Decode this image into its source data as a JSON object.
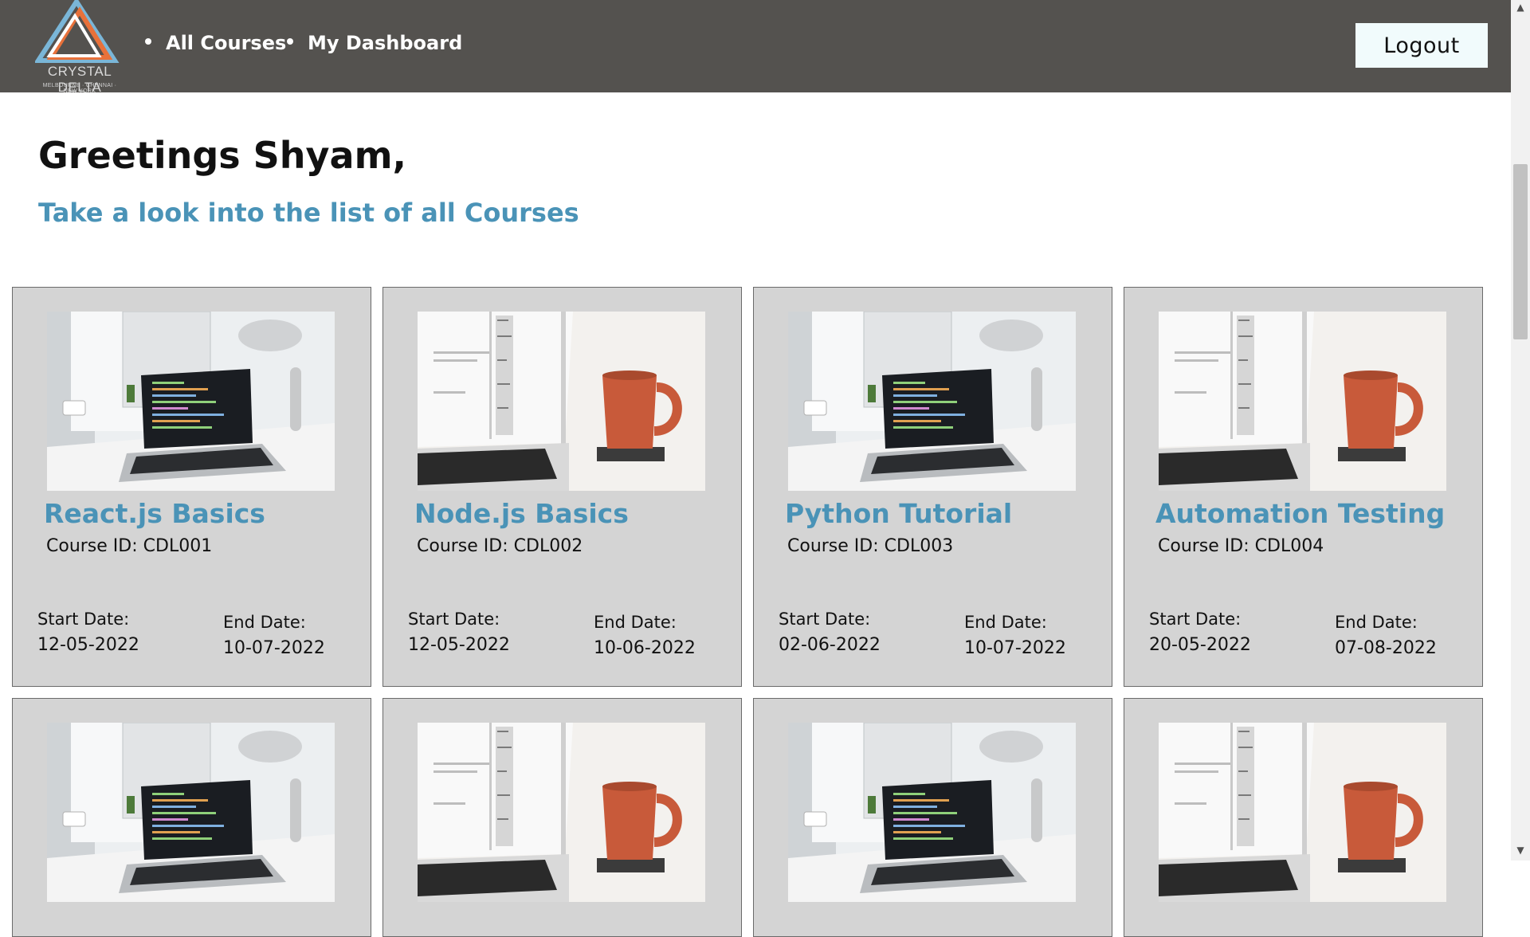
{
  "brand": {
    "name": "CRYSTAL DELTA",
    "tagline": "MELBOURNE · CHENNAI · NEW YORK"
  },
  "nav": {
    "items": [
      {
        "label": "All Courses"
      },
      {
        "label": "My Dashboard"
      }
    ],
    "logout_label": "Logout"
  },
  "page": {
    "greeting": "Greetings Shyam,",
    "subtitle": "Take a look into the list of all Courses"
  },
  "labels": {
    "course_id_prefix": "Course ID: ",
    "start_date": "Start Date:",
    "end_date": "End Date:"
  },
  "courses": [
    {
      "title": "React.js Basics",
      "id": "CDL001",
      "start": "12-05-2022",
      "end": "10-07-2022",
      "image": "laptop-desk-photo"
    },
    {
      "title": "Node.js Basics",
      "id": "CDL002",
      "start": "12-05-2022",
      "end": "10-06-2022",
      "image": "laptop-coffee-mug-photo"
    },
    {
      "title": "Python Tutorial",
      "id": "CDL003",
      "start": "02-06-2022",
      "end": "10-07-2022",
      "image": "laptop-desk-photo"
    },
    {
      "title": "Automation Testing",
      "id": "CDL004",
      "start": "20-05-2022",
      "end": "07-08-2022",
      "image": "laptop-coffee-mug-photo"
    }
  ],
  "more_courses_images": [
    "laptop-desk-photo",
    "laptop-coffee-mug-photo",
    "laptop-desk-photo",
    "laptop-coffee-mug-photo"
  ],
  "colors": {
    "navbar": "#54524f",
    "accent": "#4a93b7",
    "card": "#d4d4d4"
  }
}
